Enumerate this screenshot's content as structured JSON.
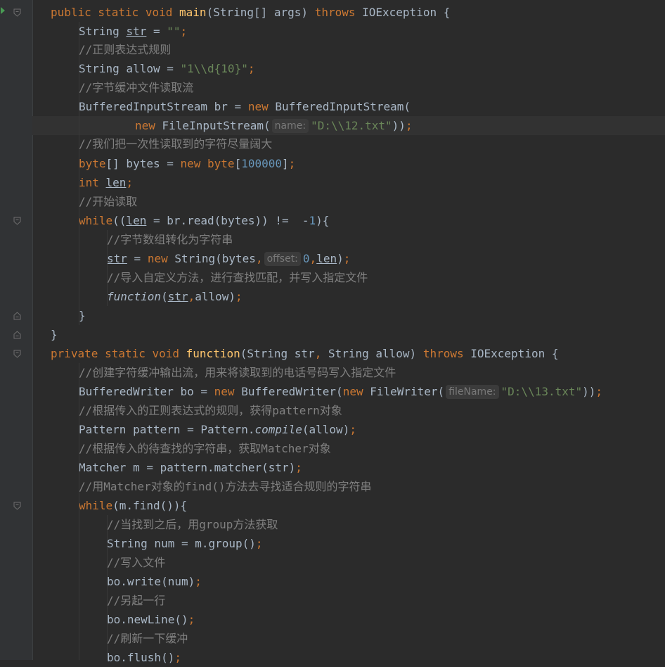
{
  "hints": {
    "name": "name:",
    "offset": "offset:",
    "fileName": "fileName:"
  },
  "lines": [
    [
      [
        "kw",
        "public static void "
      ],
      [
        "fn",
        "main"
      ],
      [
        "t",
        "(String[] args) "
      ],
      [
        "kw",
        "throws "
      ],
      [
        "t",
        "IOException {"
      ]
    ],
    [
      [
        "t",
        "String "
      ],
      [
        "ul",
        "str"
      ],
      [
        "t",
        " = "
      ],
      [
        "str",
        "\"\""
      ],
      [
        "kw",
        ";"
      ]
    ],
    [
      [
        "cm",
        "//正则表达式规则"
      ]
    ],
    [
      [
        "t",
        "String allow = "
      ],
      [
        "str",
        "\"1\\\\d{10}\""
      ],
      [
        "kw",
        ";"
      ]
    ],
    [
      [
        "cm",
        "//字节缓冲文件读取流"
      ]
    ],
    [
      [
        "t",
        "BufferedInputStream br = "
      ],
      [
        "kw",
        "new "
      ],
      [
        "t",
        "BufferedInputStream("
      ]
    ],
    [
      [
        "kw",
        "new "
      ],
      [
        "t",
        "FileInputStream("
      ],
      [
        "hint",
        "name"
      ],
      [
        "str",
        "\"D:\\\\12.txt\""
      ],
      [
        "t",
        "))"
      ],
      [
        "kw",
        ";"
      ]
    ],
    [
      [
        "cm",
        "//我们把一次性读取到的字符尽量阔大"
      ]
    ],
    [
      [
        "kw",
        "byte"
      ],
      [
        "t",
        "[] bytes = "
      ],
      [
        "kw",
        "new byte"
      ],
      [
        "t",
        "["
      ],
      [
        "num",
        "100000"
      ],
      [
        "t",
        "]"
      ],
      [
        "kw",
        ";"
      ]
    ],
    [
      [
        "kw",
        "int "
      ],
      [
        "ul",
        "len"
      ],
      [
        "kw",
        ";"
      ]
    ],
    [
      [
        "cm",
        "//开始读取"
      ]
    ],
    [
      [
        "kw",
        "while"
      ],
      [
        "t",
        "(("
      ],
      [
        "ul",
        "len"
      ],
      [
        "t",
        " = br.read(bytes)) !=  -"
      ],
      [
        "num",
        "1"
      ],
      [
        "t",
        "){"
      ]
    ],
    [
      [
        "cm",
        "//字节数组转化为字符串"
      ]
    ],
    [
      [
        "ul",
        "str"
      ],
      [
        "t",
        " = "
      ],
      [
        "kw",
        "new "
      ],
      [
        "t",
        "String(bytes"
      ],
      [
        "kw",
        ","
      ],
      [
        "hint",
        "offset"
      ],
      [
        "num",
        "0"
      ],
      [
        "kw",
        ","
      ],
      [
        "ul",
        "len"
      ],
      [
        "t",
        ")"
      ],
      [
        "kw",
        ";"
      ]
    ],
    [
      [
        "cm",
        "//导入自定义方法，进行查找匹配，并写入指定文件"
      ]
    ],
    [
      [
        "it",
        "function"
      ],
      [
        "t",
        "("
      ],
      [
        "ul",
        "str"
      ],
      [
        "kw",
        ","
      ],
      [
        "t",
        "allow)"
      ],
      [
        "kw",
        ";"
      ]
    ],
    [
      [
        "t",
        "}"
      ]
    ],
    [
      [
        "t",
        "}"
      ]
    ],
    [
      [
        "kw",
        "private static void "
      ],
      [
        "fn",
        "function"
      ],
      [
        "t",
        "(String str"
      ],
      [
        "kw",
        ", "
      ],
      [
        "t",
        "String allow) "
      ],
      [
        "kw",
        "throws "
      ],
      [
        "t",
        "IOException {"
      ]
    ],
    [
      [
        "cm",
        "//创建字符缓冲输出流，用来将读取到的电话号码写入指定文件"
      ]
    ],
    [
      [
        "t",
        "BufferedWriter bo = "
      ],
      [
        "kw",
        "new "
      ],
      [
        "t",
        "BufferedWriter("
      ],
      [
        "kw",
        "new "
      ],
      [
        "t",
        "FileWriter("
      ],
      [
        "hint",
        "fileName"
      ],
      [
        "str",
        "\"D:\\\\13.txt\""
      ],
      [
        "t",
        "))"
      ],
      [
        "kw",
        ";"
      ]
    ],
    [
      [
        "cm",
        "//根据传入的正则表达式的规则，获得pattern对象"
      ]
    ],
    [
      [
        "t",
        "Pattern pattern = Pattern."
      ],
      [
        "it",
        "compile"
      ],
      [
        "t",
        "(allow)"
      ],
      [
        "kw",
        ";"
      ]
    ],
    [
      [
        "cm",
        "//根据传入的待查找的字符串，获取Matcher对象"
      ]
    ],
    [
      [
        "t",
        "Matcher m = pattern.matcher(str)"
      ],
      [
        "kw",
        ";"
      ]
    ],
    [
      [
        "cm",
        "//用Matcher对象的find()方法去寻找适合规则的字符串"
      ]
    ],
    [
      [
        "kw",
        "while"
      ],
      [
        "t",
        "(m.find()){"
      ]
    ],
    [
      [
        "cm",
        "//当找到之后，用group方法获取"
      ]
    ],
    [
      [
        "t",
        "String num = m.group()"
      ],
      [
        "kw",
        ";"
      ]
    ],
    [
      [
        "cm",
        "//写入文件"
      ]
    ],
    [
      [
        "t",
        "bo.write(num)"
      ],
      [
        "kw",
        ";"
      ]
    ],
    [
      [
        "cm",
        "//另起一行"
      ]
    ],
    [
      [
        "t",
        "bo.newLine()"
      ],
      [
        "kw",
        ";"
      ]
    ],
    [
      [
        "cm",
        "//刷新一下缓冲"
      ]
    ],
    [
      [
        "t",
        "bo.flush()"
      ],
      [
        "kw",
        ";"
      ]
    ]
  ]
}
